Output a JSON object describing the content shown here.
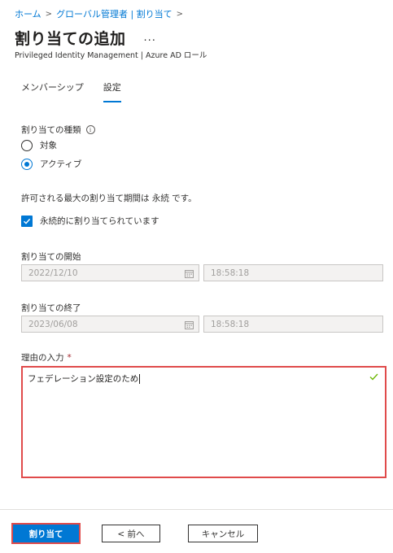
{
  "breadcrumb": {
    "items": [
      "ホーム",
      "グローバル管理者 | 割り当て"
    ]
  },
  "header": {
    "title": "割り当ての追加",
    "more": "...",
    "subtitle": "Privileged Identity Management | Azure AD ロール"
  },
  "tabs": [
    {
      "label": "メンバーシップ",
      "active": false
    },
    {
      "label": "設定",
      "active": true
    }
  ],
  "assignment_type": {
    "label": "割り当ての種類",
    "options": [
      {
        "label": "対象",
        "selected": false
      },
      {
        "label": "アクティブ",
        "selected": true
      }
    ]
  },
  "max_duration_text": "許可される最大の割り当て期間は 永続 です。",
  "permanent": {
    "label": "永続的に割り当てられています",
    "checked": true
  },
  "start": {
    "label": "割り当ての開始",
    "date": "2022/12/10",
    "time": "18:58:18"
  },
  "end": {
    "label": "割り当ての終了",
    "date": "2023/06/08",
    "time": "18:58:18"
  },
  "reason": {
    "label": "理由の入力",
    "required_mark": "*",
    "value": "フェデレーション設定のため"
  },
  "footer": {
    "assign_label": "割り当て",
    "prev_label": "< 前へ",
    "cancel_label": "キャンセル"
  },
  "colors": {
    "accent": "#0078d4",
    "highlight": "#e04b4b",
    "valid_check": "#6bb700"
  }
}
